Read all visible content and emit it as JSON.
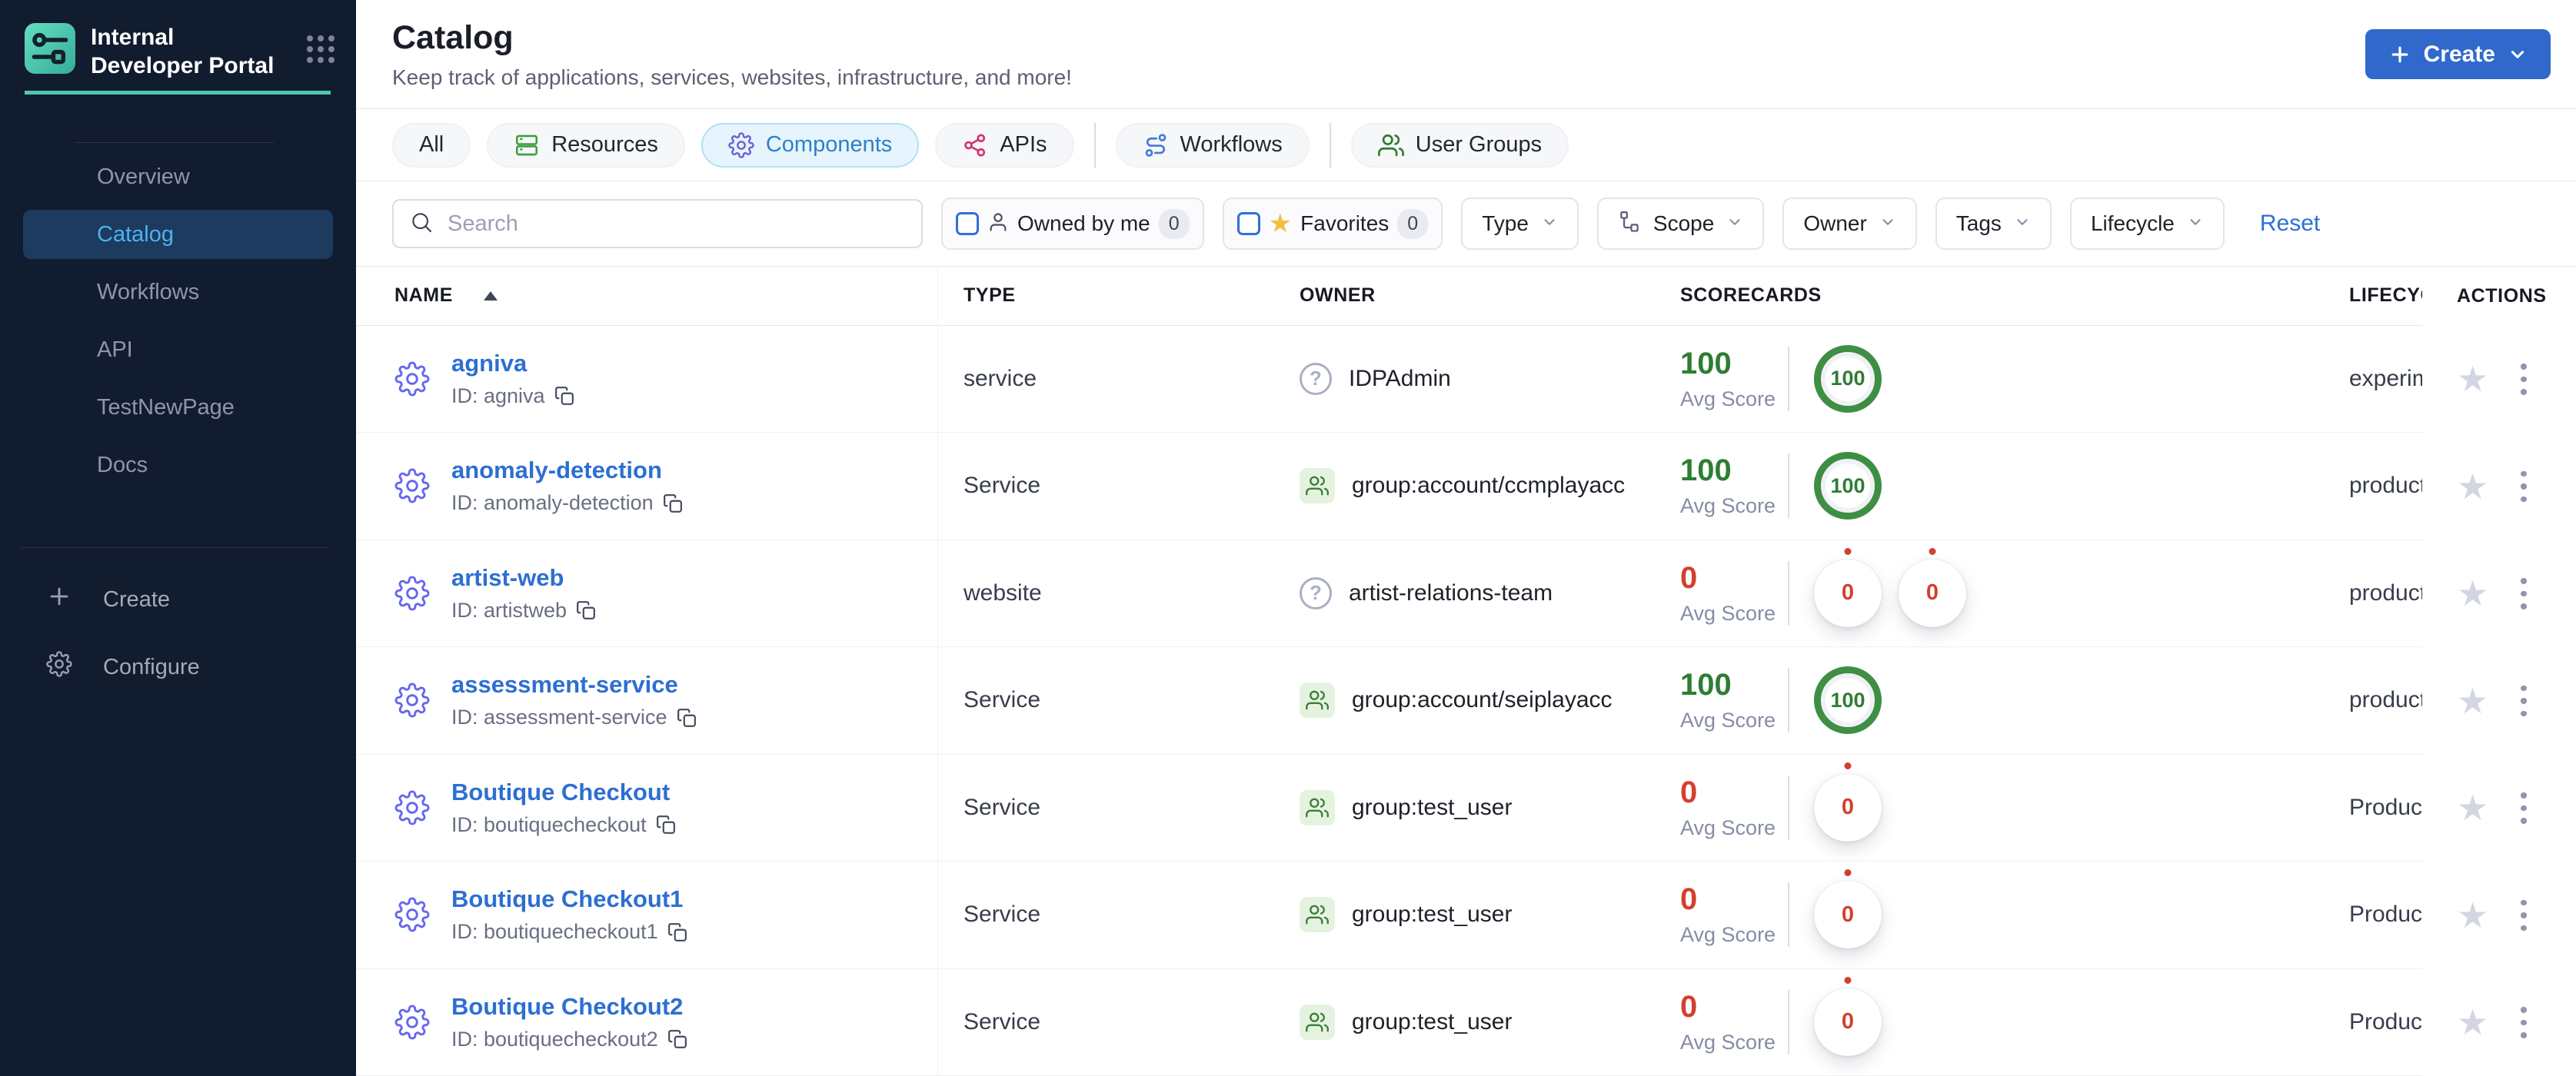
{
  "sidebar": {
    "brand_title": "Internal Developer Portal",
    "items": [
      {
        "label": "Overview",
        "active": false
      },
      {
        "label": "Catalog",
        "active": true
      },
      {
        "label": "Workflows",
        "active": false
      },
      {
        "label": "API",
        "active": false
      },
      {
        "label": "TestNewPage",
        "active": false
      },
      {
        "label": "Docs",
        "active": false
      }
    ],
    "footer_items": [
      {
        "label": "Create",
        "icon": "plus-icon"
      },
      {
        "label": "Configure",
        "icon": "gear-icon"
      }
    ]
  },
  "header": {
    "title": "Catalog",
    "subtitle": "Keep track of applications, services, websites, infrastructure, and more!",
    "create_button": "Create"
  },
  "tabs": [
    {
      "label": "All",
      "icon": "none",
      "active": false
    },
    {
      "label": "Resources",
      "icon": "resources-icon",
      "active": false
    },
    {
      "label": "Components",
      "icon": "components-gear-icon",
      "active": true
    },
    {
      "label": "APIs",
      "icon": "apis-share-icon",
      "active": false
    },
    {
      "label": "Workflows",
      "icon": "workflows-route-icon",
      "active": false
    },
    {
      "label": "User Groups",
      "icon": "user-groups-icon",
      "active": false
    }
  ],
  "filters": {
    "search_placeholder": "Search",
    "owned_by_me": {
      "label": "Owned by me",
      "count": "0",
      "icon": "person-icon"
    },
    "favorites": {
      "label": "Favorites",
      "count": "0",
      "icon": "star-icon"
    },
    "dropdowns": [
      {
        "label": "Type"
      },
      {
        "label": "Scope",
        "icon": "hierarchy-icon"
      },
      {
        "label": "Owner"
      },
      {
        "label": "Tags"
      },
      {
        "label": "Lifecycle"
      }
    ],
    "reset_label": "Reset"
  },
  "table": {
    "columns": [
      "NAME",
      "TYPE",
      "OWNER",
      "SCORECARDS",
      "LIFECYCLE",
      "ACTIONS"
    ],
    "avg_score_label": "Avg Score",
    "rows": [
      {
        "name": "agniva",
        "id": "ID: agniva",
        "type": "service",
        "owner": "IDPAdmin",
        "owner_icon": "help",
        "avg_score": "100",
        "score_state": "good",
        "badges": [
          {
            "value": "100",
            "state": "good"
          }
        ],
        "lifecycle": "experimental"
      },
      {
        "name": "anomaly-detection",
        "id": "ID: anomaly-detection",
        "type": "Service",
        "owner": "group:account/ccmplayacc",
        "owner_icon": "group",
        "avg_score": "100",
        "score_state": "good",
        "badges": [
          {
            "value": "100",
            "state": "good"
          }
        ],
        "lifecycle": "production"
      },
      {
        "name": "artist-web",
        "id": "ID: artistweb",
        "type": "website",
        "owner": "artist-relations-team",
        "owner_icon": "help",
        "avg_score": "0",
        "score_state": "bad",
        "badges": [
          {
            "value": "0",
            "state": "bad"
          },
          {
            "value": "0",
            "state": "bad"
          }
        ],
        "lifecycle": "production"
      },
      {
        "name": "assessment-service",
        "id": "ID: assessment-service",
        "type": "Service",
        "owner": "group:account/seiplayacc",
        "owner_icon": "group",
        "avg_score": "100",
        "score_state": "good",
        "badges": [
          {
            "value": "100",
            "state": "good"
          }
        ],
        "lifecycle": "production"
      },
      {
        "name": "Boutique Checkout",
        "id": "ID: boutiquecheckout",
        "type": "Service",
        "owner": "group:test_user",
        "owner_icon": "group",
        "avg_score": "0",
        "score_state": "bad",
        "badges": [
          {
            "value": "0",
            "state": "bad"
          }
        ],
        "lifecycle": "Production"
      },
      {
        "name": "Boutique Checkout1",
        "id": "ID: boutiquecheckout1",
        "type": "Service",
        "owner": "group:test_user",
        "owner_icon": "group",
        "avg_score": "0",
        "score_state": "bad",
        "badges": [
          {
            "value": "0",
            "state": "bad"
          }
        ],
        "lifecycle": "Production"
      },
      {
        "name": "Boutique Checkout2",
        "id": "ID: boutiquecheckout2",
        "type": "Service",
        "owner": "group:test_user",
        "owner_icon": "group",
        "avg_score": "0",
        "score_state": "bad",
        "badges": [
          {
            "value": "0",
            "state": "bad"
          }
        ],
        "lifecycle": "Production"
      }
    ]
  },
  "colors": {
    "sidebar_bg": "#111c2e",
    "brand_teal": "#4fc9ae",
    "primary_button_blue": "#3069cb",
    "link_blue": "#2d6fd1",
    "active_tab_blue": "#2e80c8",
    "active_nav_bg": "#1d3a5f",
    "active_nav_text": "#4db2ef",
    "score_green": "#2e7d33",
    "score_red": "#d43f2e",
    "row_gear_indigo": "#6366f1",
    "owner_group_green": "#3e7d3a"
  }
}
